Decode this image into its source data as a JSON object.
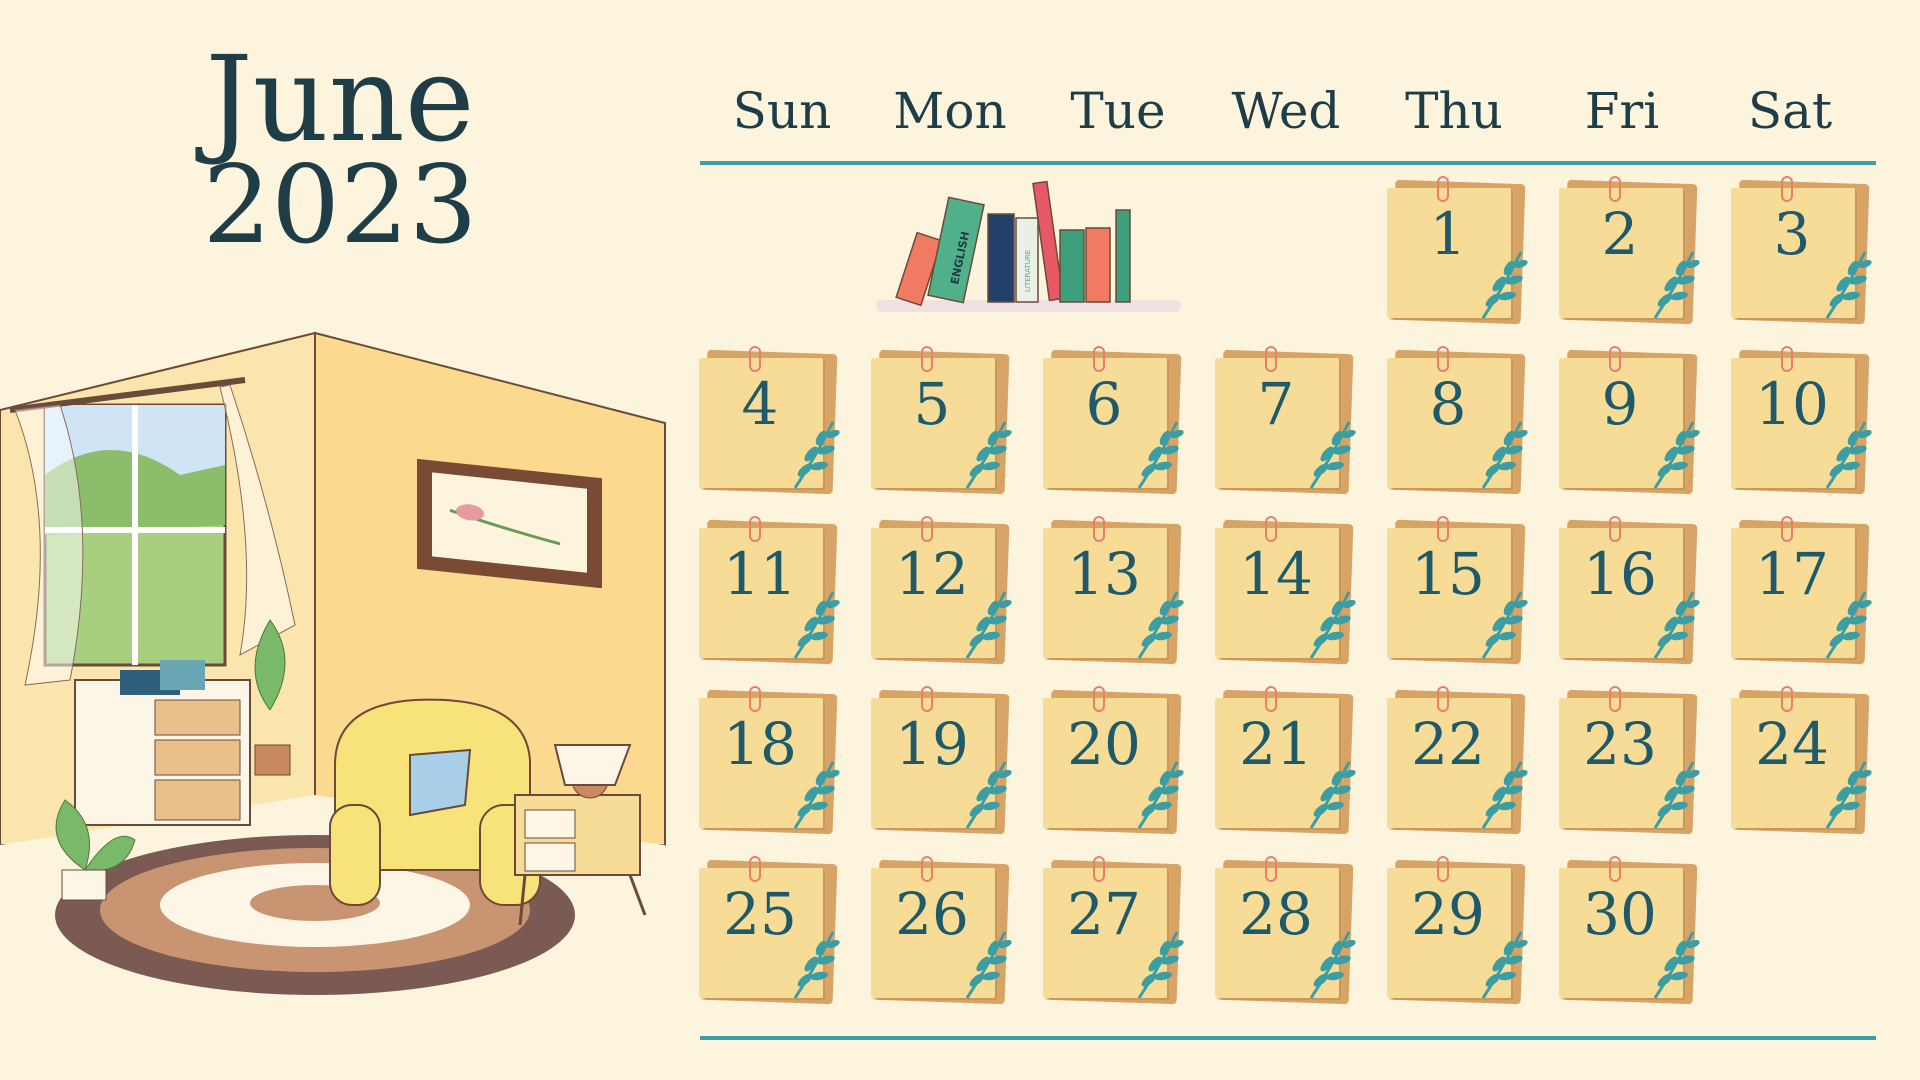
{
  "calendar": {
    "month": "June",
    "year": "2023",
    "weekdays": [
      "Sun",
      "Mon",
      "Tue",
      "Wed",
      "Thu",
      "Fri",
      "Sat"
    ],
    "first_weekday_index": 4,
    "days": [
      "1",
      "2",
      "3",
      "4",
      "5",
      "6",
      "7",
      "8",
      "9",
      "10",
      "11",
      "12",
      "13",
      "14",
      "15",
      "16",
      "17",
      "18",
      "19",
      "20",
      "21",
      "22",
      "23",
      "24",
      "25",
      "26",
      "27",
      "28",
      "29",
      "30"
    ]
  },
  "bookshelf": {
    "book_labels": [
      "ENGLISH",
      "LITERATURE"
    ]
  },
  "colors": {
    "background": "#fdf4dd",
    "text": "#1e3d47",
    "accent_rule": "#3c9ea5",
    "note": "#f7dc98",
    "note_back": "#d7a466",
    "pin": "#e97f6a",
    "leaf": "#3c9ea5"
  }
}
